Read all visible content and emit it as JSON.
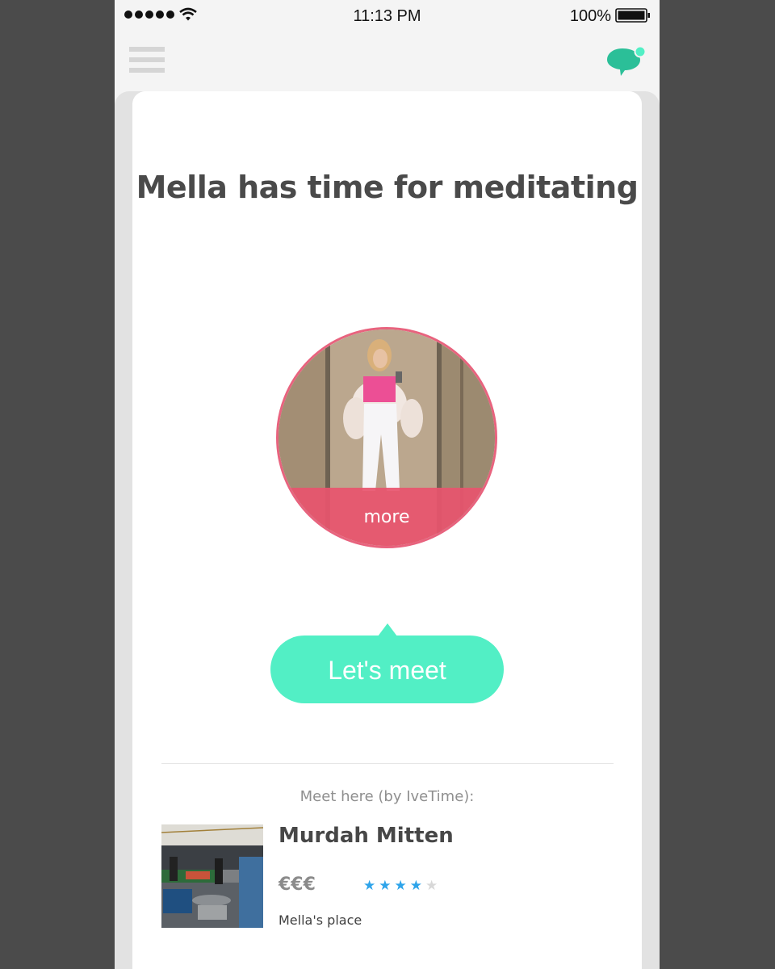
{
  "status_bar": {
    "time": "11:13 PM",
    "battery": "100%",
    "signal_bars": 5,
    "icons": [
      "signal-dots-icon",
      "wifi-icon",
      "battery-icon"
    ]
  },
  "nav": {
    "menu_icon": "hamburger-icon",
    "chat_icon": "chat-bubble-icon",
    "chat_accent": "#2bbf98",
    "has_unread": true
  },
  "card": {
    "title": "Mella has time for meditating",
    "avatar_overlay_label": "more",
    "avatar_accent": "#e8546e",
    "cta_label": "Let's meet",
    "cta_color": "#52efc5"
  },
  "venue": {
    "heading": "Meet here (by IveTime):",
    "name": "Murdah Mitten",
    "price": "€€€",
    "rating": 4,
    "rating_max": 5,
    "host_label": "Mella's place"
  }
}
